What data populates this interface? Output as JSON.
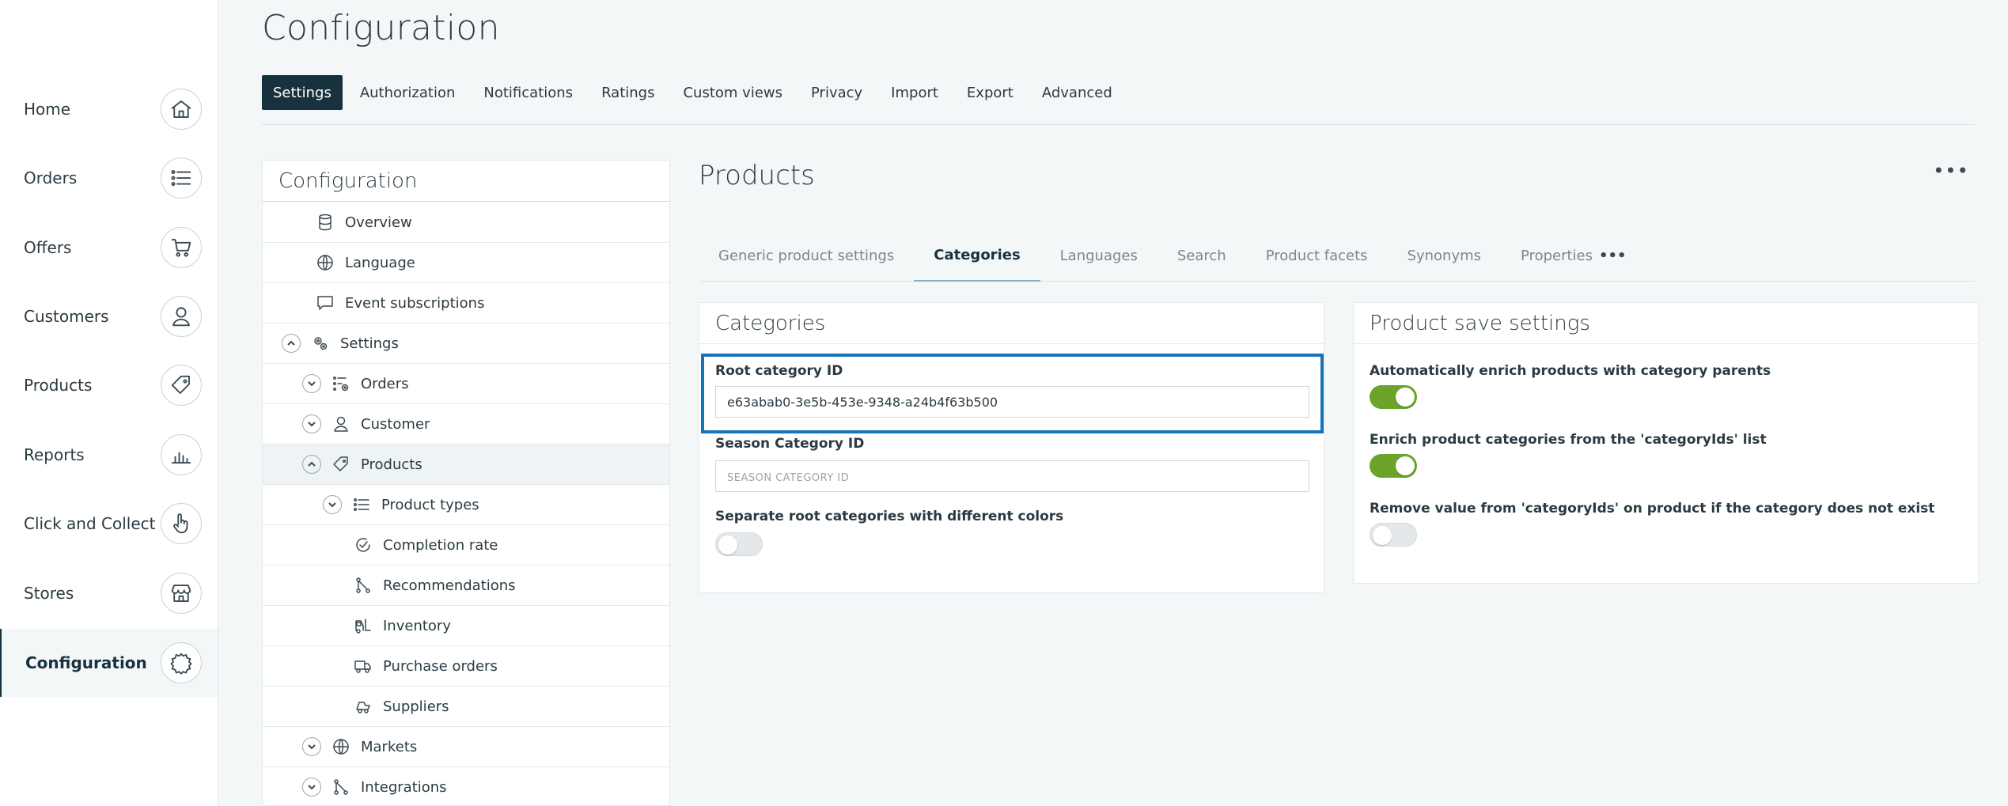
{
  "page": {
    "title": "Configuration"
  },
  "sidenav": {
    "items": [
      {
        "label": "Home",
        "icon": "home-icon"
      },
      {
        "label": "Orders",
        "icon": "list-icon"
      },
      {
        "label": "Offers",
        "icon": "cart-icon"
      },
      {
        "label": "Customers",
        "icon": "user-icon"
      },
      {
        "label": "Products",
        "icon": "tag-icon"
      },
      {
        "label": "Reports",
        "icon": "bar-chart-icon"
      },
      {
        "label": "Click and Collect",
        "icon": "hand-pointer-icon"
      },
      {
        "label": "Stores",
        "icon": "store-icon"
      },
      {
        "label": "Configuration",
        "icon": "gear-icon",
        "active": true
      }
    ]
  },
  "toptabs": [
    "Settings",
    "Authorization",
    "Notifications",
    "Ratings",
    "Custom views",
    "Privacy",
    "Import",
    "Export",
    "Advanced"
  ],
  "tree": {
    "title": "Configuration",
    "rows": [
      {
        "label": "Overview",
        "icon": "database-icon"
      },
      {
        "label": "Language",
        "icon": "globe-icon"
      },
      {
        "label": "Event subscriptions",
        "icon": "message-icon"
      },
      {
        "label": "Settings",
        "icon": "gears-icon",
        "expanded": true
      },
      {
        "label": "Orders",
        "icon": "list-gear-icon",
        "expanded": false
      },
      {
        "label": "Customer",
        "icon": "user-icon",
        "expanded": false
      },
      {
        "label": "Products",
        "icon": "tag-icon",
        "expanded": true,
        "selected": true
      },
      {
        "label": "Product types",
        "icon": "list-icon",
        "expanded": false
      },
      {
        "label": "Completion rate",
        "icon": "check-circle-icon"
      },
      {
        "label": "Recommendations",
        "icon": "nodes-icon"
      },
      {
        "label": "Inventory",
        "icon": "forklift-icon"
      },
      {
        "label": "Purchase orders",
        "icon": "truck-icon"
      },
      {
        "label": "Suppliers",
        "icon": "delivery-icon"
      },
      {
        "label": "Markets",
        "icon": "globe-icon",
        "expanded": false
      },
      {
        "label": "Integrations",
        "icon": "nodes-icon",
        "expanded": false
      }
    ]
  },
  "content": {
    "title": "Products",
    "more_label": "•••",
    "subtabs": [
      "Generic product settings",
      "Categories",
      "Languages",
      "Search",
      "Product facets",
      "Synonyms",
      "Properties"
    ],
    "subtabs_more": "•••",
    "categories_card": {
      "title": "Categories",
      "root_label": "Root category ID",
      "root_value": "e63abab0-3e5b-453e-9348-a24b4f63b500",
      "season_label": "Season Category ID",
      "season_placeholder": "SEASON CATEGORY ID",
      "separate_label": "Separate root categories with different colors",
      "separate_on": false
    },
    "save_card": {
      "title": "Product save settings",
      "opt1_label": "Automatically enrich products with category parents",
      "opt1_on": true,
      "opt2_label": "Enrich product categories from the 'categoryIds' list",
      "opt2_on": true,
      "opt3_label": "Remove value from 'categoryIds' on product if the category does not exist",
      "opt3_on": false
    }
  },
  "colors": {
    "accent": "#17313f",
    "toggle_on": "#6aa42a",
    "focus": "#1673b8"
  }
}
